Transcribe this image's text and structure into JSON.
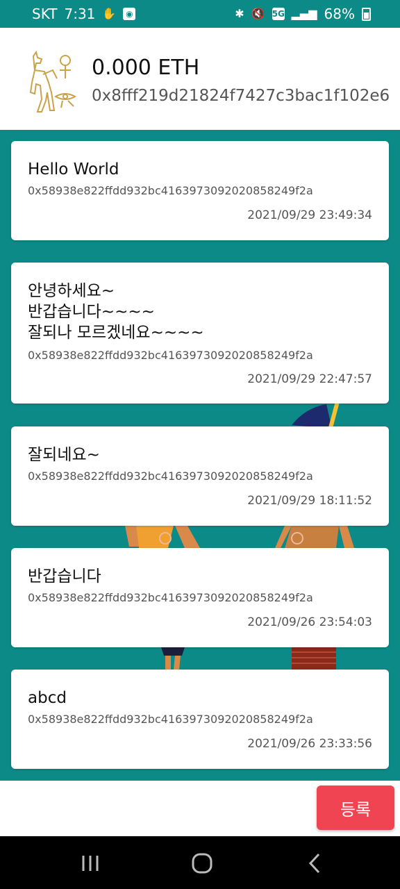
{
  "status_bar": {
    "carrier": "SKT",
    "time": "7:31",
    "network": "5G",
    "battery": "68%"
  },
  "wallet": {
    "balance": "0.000 ETH",
    "address": "0x8fff219d21824f7427c3bac1f102e6"
  },
  "posts": [
    {
      "message": "Hello World",
      "hash": "0x58938e822ffdd932bc4163973092020858249f2a",
      "timestamp": "2021/09/29 23:49:34"
    },
    {
      "message": "안녕하세요~\n반갑습니다~~~~\n잘되나 모르겠네요~~~~",
      "hash": "0x58938e822ffdd932bc4163973092020858249f2a",
      "timestamp": "2021/09/29 22:47:57"
    },
    {
      "message": "잘되네요~",
      "hash": "0x58938e822ffdd932bc4163973092020858249f2a",
      "timestamp": "2021/09/29 18:11:52"
    },
    {
      "message": "반갑습니다",
      "hash": "0x58938e822ffdd932bc4163973092020858249f2a",
      "timestamp": "2021/09/26 23:54:03"
    },
    {
      "message": "abcd",
      "hash": "0x58938e822ffdd932bc4163973092020858249f2a",
      "timestamp": "2021/09/26 23:33:56"
    }
  ],
  "actions": {
    "register_label": "등록"
  },
  "colors": {
    "accent": "#0b8a87",
    "button": "#f04452"
  }
}
